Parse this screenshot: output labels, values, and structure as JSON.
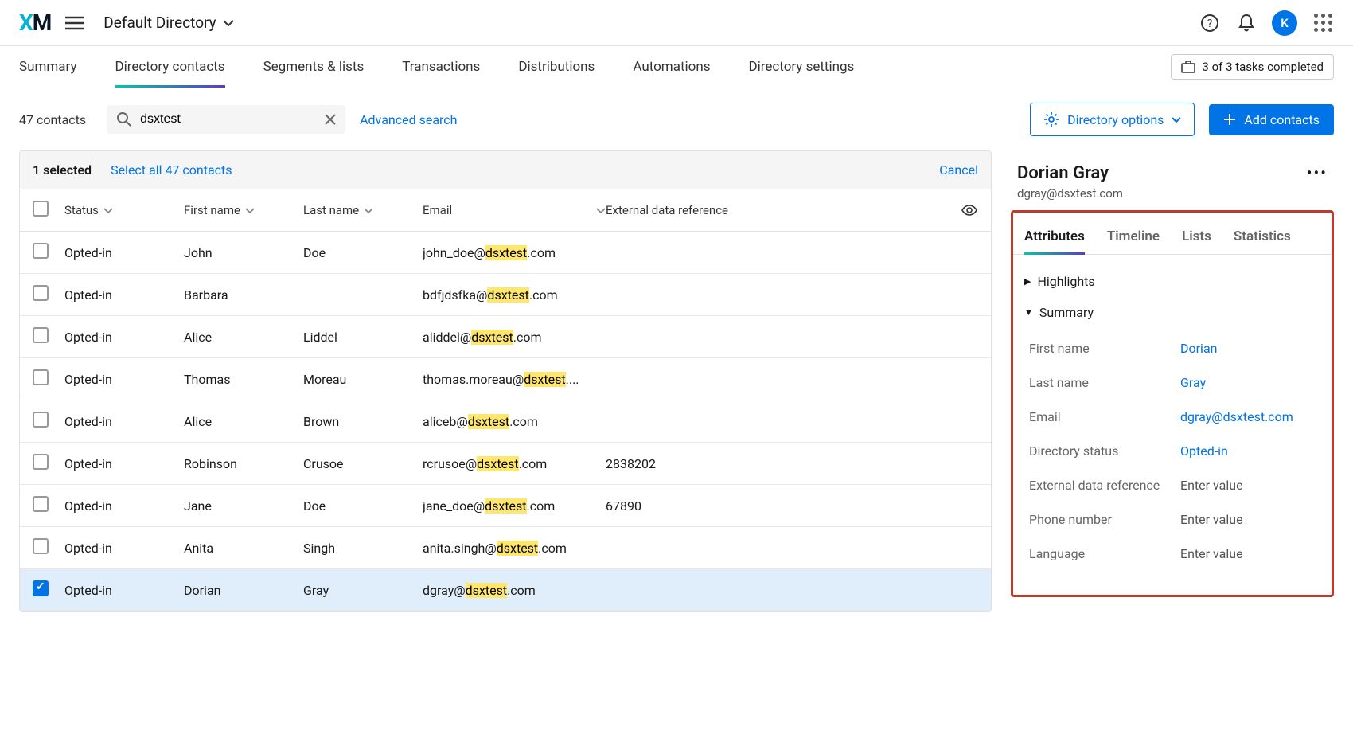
{
  "header": {
    "directory_label": "Default Directory",
    "avatar_letter": "K"
  },
  "tabs": [
    "Summary",
    "Directory contacts",
    "Segments & lists",
    "Transactions",
    "Distributions",
    "Automations",
    "Directory settings"
  ],
  "active_tab": "Directory contacts",
  "tasks_badge": "3 of 3 tasks completed",
  "toolbar": {
    "contact_count": "47 contacts",
    "search_value": "dsxtest",
    "advanced_search": "Advanced search",
    "directory_options": "Directory options",
    "add_contacts": "Add contacts"
  },
  "selection": {
    "count_label": "1 selected",
    "select_all": "Select all 47 contacts",
    "cancel": "Cancel"
  },
  "columns": {
    "status": "Status",
    "first": "First name",
    "last": "Last name",
    "email": "Email",
    "ext": "External data reference"
  },
  "highlight": "dsxtest",
  "rows": [
    {
      "checked": false,
      "status": "Opted-in",
      "first": "John",
      "last": "Doe",
      "email_pre": "john_doe@",
      "email_post": ".com",
      "ext": ""
    },
    {
      "checked": false,
      "status": "Opted-in",
      "first": "Barbara",
      "last": "",
      "email_pre": "bdfjdsfka@",
      "email_post": ".com",
      "ext": ""
    },
    {
      "checked": false,
      "status": "Opted-in",
      "first": "Alice",
      "last": "Liddel",
      "email_pre": "aliddel@",
      "email_post": ".com",
      "ext": ""
    },
    {
      "checked": false,
      "status": "Opted-in",
      "first": "Thomas",
      "last": "Moreau",
      "email_pre": "thomas.moreau@",
      "email_post": "....",
      "ext": ""
    },
    {
      "checked": false,
      "status": "Opted-in",
      "first": "Alice",
      "last": "Brown",
      "email_pre": "aliceb@",
      "email_post": ".com",
      "ext": ""
    },
    {
      "checked": false,
      "status": "Opted-in",
      "first": "Robinson",
      "last": "Crusoe",
      "email_pre": "rcrusoe@",
      "email_post": ".com",
      "ext": "2838202"
    },
    {
      "checked": false,
      "status": "Opted-in",
      "first": "Jane",
      "last": "Doe",
      "email_pre": "jane_doe@",
      "email_post": ".com",
      "ext": "67890"
    },
    {
      "checked": false,
      "status": "Opted-in",
      "first": "Anita",
      "last": "Singh",
      "email_pre": "anita.singh@",
      "email_post": ".com",
      "ext": ""
    },
    {
      "checked": true,
      "status": "Opted-in",
      "first": "Dorian",
      "last": "Gray",
      "email_pre": "dgray@",
      "email_post": ".com",
      "ext": ""
    }
  ],
  "detail": {
    "name": "Dorian Gray",
    "email": "dgray@dsxtest.com",
    "tabs": [
      "Attributes",
      "Timeline",
      "Lists",
      "Statistics"
    ],
    "active_tab": "Attributes",
    "sections": {
      "highlights": "Highlights",
      "summary": "Summary"
    },
    "fields": [
      {
        "label": "First name",
        "value": "Dorian",
        "placeholder": false
      },
      {
        "label": "Last name",
        "value": "Gray",
        "placeholder": false
      },
      {
        "label": "Email",
        "value": "dgray@dsxtest.com",
        "placeholder": false
      },
      {
        "label": "Directory status",
        "value": "Opted-in",
        "placeholder": false
      },
      {
        "label": "External data reference",
        "value": "Enter value",
        "placeholder": true
      },
      {
        "label": "Phone number",
        "value": "Enter value",
        "placeholder": true
      },
      {
        "label": "Language",
        "value": "Enter value",
        "placeholder": true
      }
    ]
  }
}
